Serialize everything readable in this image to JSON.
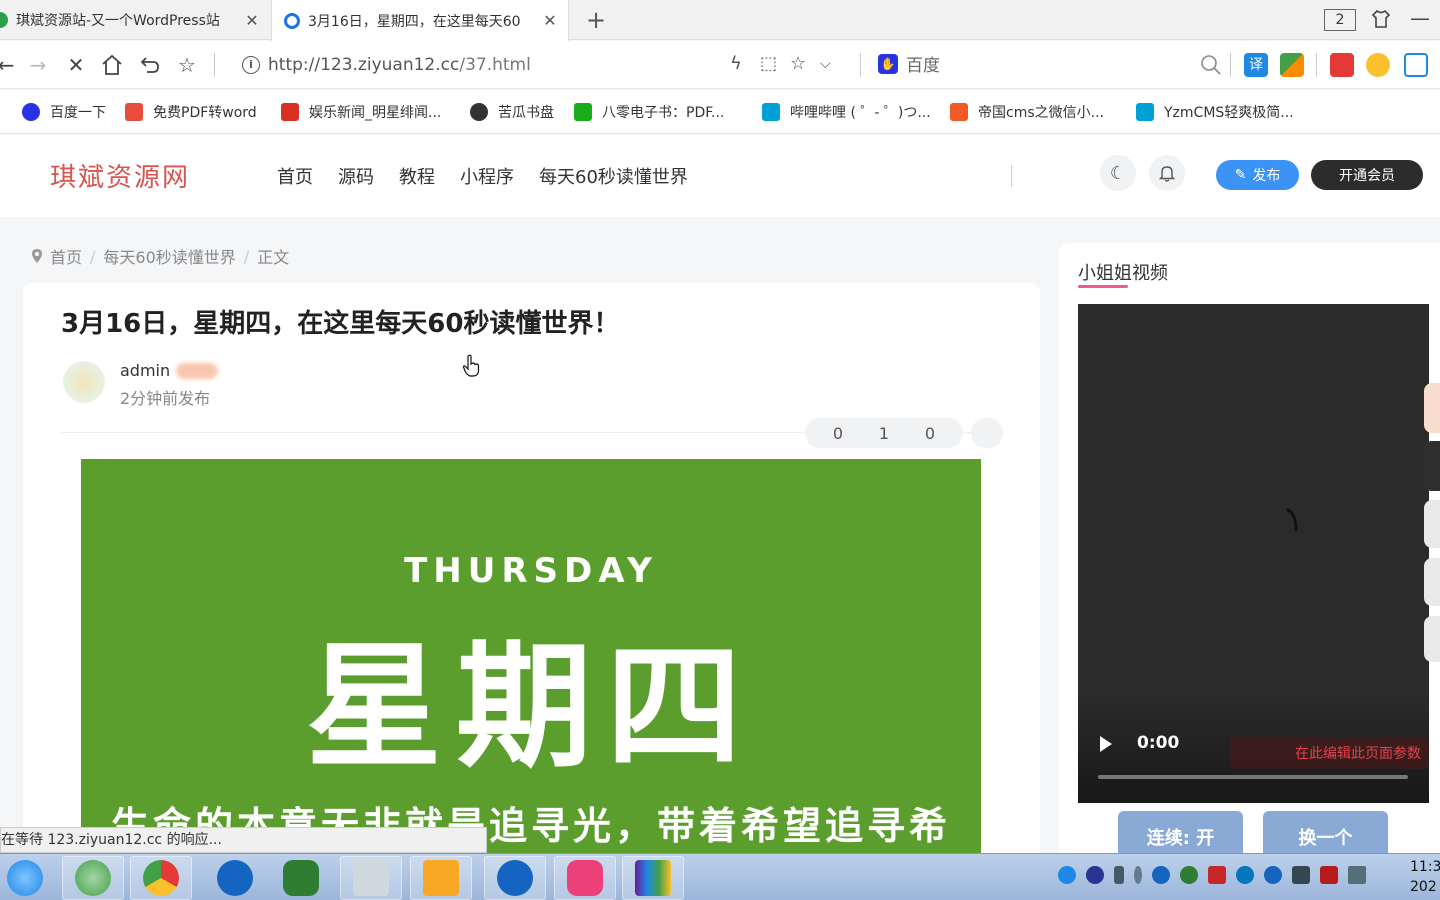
{
  "browser": {
    "tabs": [
      {
        "title": "琪斌资源站-又一个WordPress站"
      },
      {
        "title": "3月16日，星期四，在这里每天60"
      }
    ],
    "tab_count": "2",
    "url_host": "http://123.ziyuan12.cc",
    "url_path": "/37.html",
    "search_engine": "百度",
    "bookmarks": [
      {
        "label": "百度一下",
        "icon": "baidu-icon",
        "color": "#2932e1"
      },
      {
        "label": "免费PDF转word",
        "icon": "pdf-icon",
        "color": "#e74c3c"
      },
      {
        "label": "娱乐新闻_明星绯闻...",
        "icon": "gmail-m-icon",
        "color": "#d93025"
      },
      {
        "label": "苦瓜书盘",
        "icon": "globe-icon",
        "color": "#333333"
      },
      {
        "label": "八零电子书：PDF...",
        "icon": "wechat-icon",
        "color": "#1aad19"
      },
      {
        "label": "哔哩哔哩 ( ゜- ゜)つ...",
        "icon": "bilibili-icon",
        "color": "#00a1d6"
      },
      {
        "label": "帝国cms之微信小...",
        "icon": "c-icon",
        "color": "#f15a24"
      },
      {
        "label": "YzmCMS轻爽极简...",
        "icon": "bilibili-icon",
        "color": "#00a1d6"
      }
    ],
    "status_text": "正在等待 123.ziyuan12.cc 的响应..."
  },
  "site": {
    "logo": "琪斌资源网",
    "menu": [
      "首页",
      "源码",
      "教程",
      "小程序",
      "每天60秒读懂世界"
    ],
    "publish_label": "发布",
    "vip_label": "开通会员",
    "accent": "#3b93f5"
  },
  "breadcrumb": [
    "首页",
    "每天60秒读懂世界",
    "正文"
  ],
  "article": {
    "title": "3月16日，星期四，在这里每天60秒读懂世界！",
    "author": "admin",
    "time": "2分钟前发布",
    "stats": [
      "0",
      "1",
      "0"
    ],
    "image": {
      "en": "THURSDAY",
      "zh": "星期四",
      "quote": "生命的本意无非就是追寻光，带着希望追寻希望。",
      "bg_color": "#5c9e2e"
    }
  },
  "sidebar": {
    "title": "小姐姐视频",
    "video_time": "0:00",
    "edit_hint": "在此编辑此页面参数",
    "btn_continue": "连续: 开",
    "btn_switch": "换一个"
  },
  "taskbar": {
    "clock_time": "11:3",
    "clock_date": "202",
    "apps": [
      {
        "name": "ie-icon",
        "color": "#1e88e5"
      },
      {
        "name": "green-browser-icon",
        "color": "#43a047"
      },
      {
        "name": "chrome-icon",
        "color": "#f4b400"
      },
      {
        "name": "feather-icon",
        "color": "#1565c0"
      },
      {
        "name": "wechat-icon",
        "color": "#2e7d32"
      },
      {
        "name": "notepad-icon",
        "color": "#90a4ae"
      },
      {
        "name": "folder-icon",
        "color": "#f9a825"
      },
      {
        "name": "video-app-icon",
        "color": "#1565c0"
      },
      {
        "name": "meitu-icon",
        "color": "#ec407a"
      },
      {
        "name": "winrar-icon",
        "color": "#6a1b9a"
      }
    ]
  }
}
